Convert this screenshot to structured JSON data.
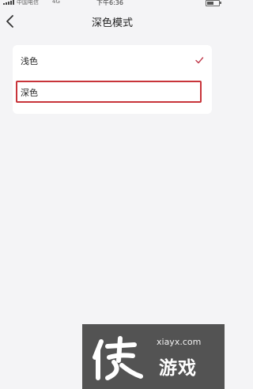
{
  "status_bar": {
    "carrier": "中国电信",
    "network": "4G",
    "time": "下午6:36"
  },
  "header": {
    "title": "深色模式",
    "back_icon": "chevron-left-icon"
  },
  "options": [
    {
      "label": "浅色",
      "selected": true,
      "icon": "check-icon"
    },
    {
      "label": "深色",
      "selected": false,
      "highlighted": true
    }
  ],
  "colors": {
    "background": "#f4f4f6",
    "card": "#ffffff",
    "check": "#c0394a",
    "highlight_border": "#c8343a"
  },
  "watermark": {
    "site": "xiayx.com",
    "brand": "游戏",
    "logo_glyph": "侠"
  }
}
